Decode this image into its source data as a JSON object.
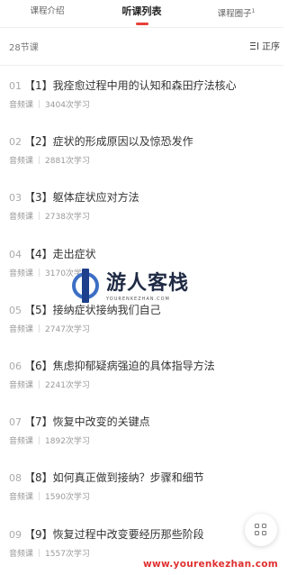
{
  "tabs": [
    {
      "label": "课程介绍"
    },
    {
      "label": "听课列表"
    },
    {
      "label": "课程圈子",
      "badge": "1"
    }
  ],
  "list_header": {
    "count": "28节课",
    "sort_label": "正序"
  },
  "lessons": [
    {
      "num": "01",
      "title": "【1】我痊愈过程中用的认知和森田疗法核心",
      "type": "音频课",
      "plays": "3404次学习"
    },
    {
      "num": "02",
      "title": "【2】症状的形成原因以及惊恐发作",
      "type": "音频课",
      "plays": "2881次学习"
    },
    {
      "num": "03",
      "title": "【3】躯体症状应对方法",
      "type": "音频课",
      "plays": "2738次学习"
    },
    {
      "num": "04",
      "title": "【4】走出症状",
      "type": "音频课",
      "plays": "3170次学习"
    },
    {
      "num": "05",
      "title": "【5】接纳症状接纳我们自己",
      "type": "音频课",
      "plays": "2747次学习"
    },
    {
      "num": "06",
      "title": "【6】焦虑抑郁疑病强迫的具体指导方法",
      "type": "音频课",
      "plays": "2241次学习"
    },
    {
      "num": "07",
      "title": "【7】恢复中改变的关键点",
      "type": "音频课",
      "plays": "1892次学习"
    },
    {
      "num": "08",
      "title": "【8】如何真正做到接纳？步骤和细节",
      "type": "音频课",
      "plays": "1590次学习"
    },
    {
      "num": "09",
      "title": "【9】恢复过程中改变要经历那些阶段",
      "type": "音频课",
      "plays": "1557次学习"
    }
  ],
  "watermark": {
    "title": "游人客栈",
    "subtitle": "YOURENKEZHAN.COM",
    "url": "www.yourenkezhan.com"
  },
  "icons": {
    "sort": "sort-icon",
    "floating": "grid-icon"
  },
  "colors": {
    "accent": "#e8413a",
    "watermark_url": "#e03030"
  }
}
